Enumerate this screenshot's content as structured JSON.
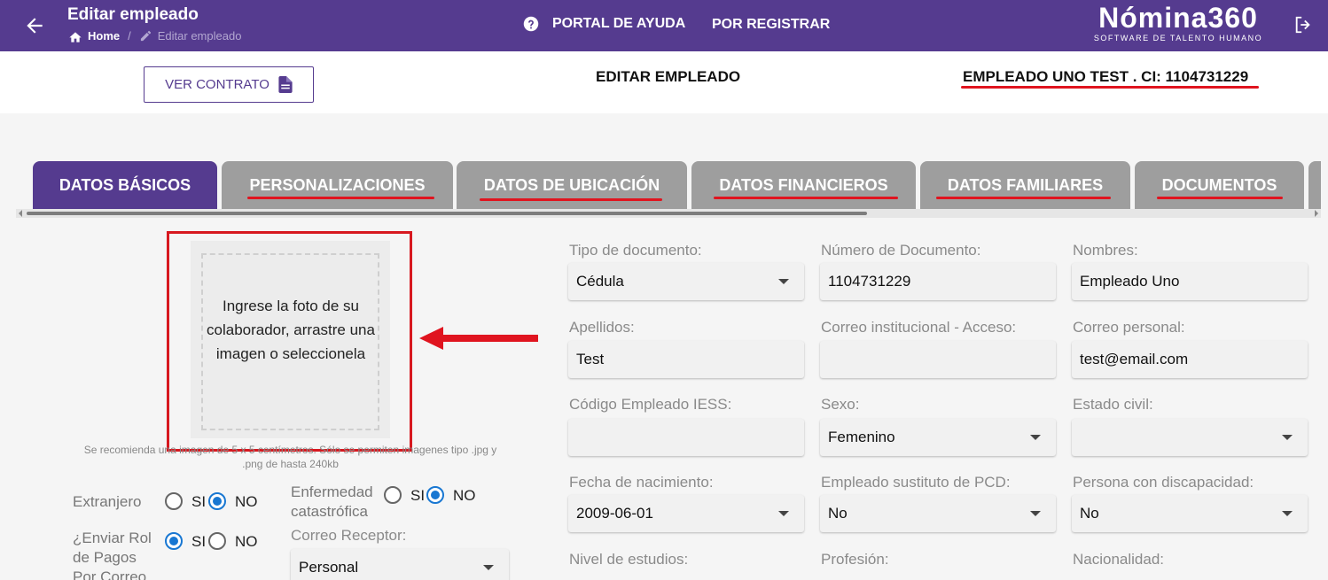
{
  "topbar": {
    "title": "Editar empleado",
    "breadcrumb": {
      "home": "Home",
      "separator": "/",
      "current": "Editar empleado"
    },
    "help_label": "PORTAL DE AYUDA",
    "register_label": "POR REGISTRAR",
    "brand": {
      "name": "Nómina360",
      "tagline": "SOFTWARE DE TALENTO HUMANO"
    }
  },
  "header": {
    "contract_button": "VER CONTRATO",
    "title": "EDITAR EMPLEADO",
    "employee": "EMPLEADO UNO TEST . CI: 1104731229"
  },
  "tabs": [
    {
      "label": "DATOS BÁSICOS",
      "active": true
    },
    {
      "label": "PERSONALIZACIONES",
      "active": false
    },
    {
      "label": "DATOS DE UBICACIÓN",
      "active": false
    },
    {
      "label": "DATOS FINANCIEROS",
      "active": false
    },
    {
      "label": "DATOS FAMILIARES",
      "active": false
    },
    {
      "label": "DOCUMENTOS",
      "active": false
    }
  ],
  "photo": {
    "upload_text": "Ingrese la foto de su colaborador, arrastre una imagen o seleccionela",
    "hint": "Se recomienda una imagen de 5 x 5 centímetros. Sólo se permiten imagenes tipo .jpg y .png de hasta 240kb"
  },
  "options": {
    "extranjero": {
      "label": "Extranjero",
      "yes": "SI",
      "no": "NO",
      "selected": "NO"
    },
    "enfermedad": {
      "label_line1": "Enfermedad",
      "label_line2": "catastrófica",
      "yes": "SI",
      "no": "NO",
      "selected": "NO"
    },
    "rol_pagos": {
      "label_line1": "¿Enviar Rol",
      "label_line2": "de Pagos",
      "label_line3": "Por Correo",
      "yes": "SI",
      "no": "NO",
      "selected": "SI"
    },
    "correo_receptor": {
      "label": "Correo Receptor:",
      "value": "Personal"
    }
  },
  "form": {
    "tipo_documento": {
      "label": "Tipo de documento:",
      "value": "Cédula"
    },
    "numero_documento": {
      "label": "Número de Documento:",
      "value": "1104731229"
    },
    "nombres": {
      "label": "Nombres:",
      "value": "Empleado Uno"
    },
    "apellidos": {
      "label": "Apellidos:",
      "value": "Test"
    },
    "correo_institucional": {
      "label": "Correo institucional - Acceso:",
      "value": ""
    },
    "correo_personal": {
      "label": "Correo personal:",
      "value": "test@email.com"
    },
    "codigo_iess": {
      "label": "Código Empleado IESS:",
      "value": ""
    },
    "sexo": {
      "label": "Sexo:",
      "value": "Femenino"
    },
    "estado_civil": {
      "label": "Estado civil:",
      "value": ""
    },
    "fecha_nacimiento": {
      "label": "Fecha de nacimiento:",
      "value": "2009-06-01"
    },
    "sustituto_pcd": {
      "label": "Empleado sustituto de PCD:",
      "value": "No"
    },
    "discapacidad": {
      "label": "Persona con discapacidad:",
      "value": "No"
    },
    "nivel_estudios": {
      "label": "Nivel de estudios:"
    },
    "profesion": {
      "label": "Profesión:"
    },
    "nacionalidad": {
      "label": "Nacionalidad:"
    }
  },
  "colors": {
    "primary": "#553b8f",
    "tab_inactive": "#9e9e9e",
    "annotation_red": "#e0141f",
    "radio_blue": "#1877d2"
  },
  "icons": {
    "back": "arrow-left-icon",
    "home": "home-icon",
    "edit": "pencil-icon",
    "help": "question-circle-icon",
    "logout": "logout-icon",
    "contract": "document-icon",
    "dropdown": "caret-down-icon"
  }
}
